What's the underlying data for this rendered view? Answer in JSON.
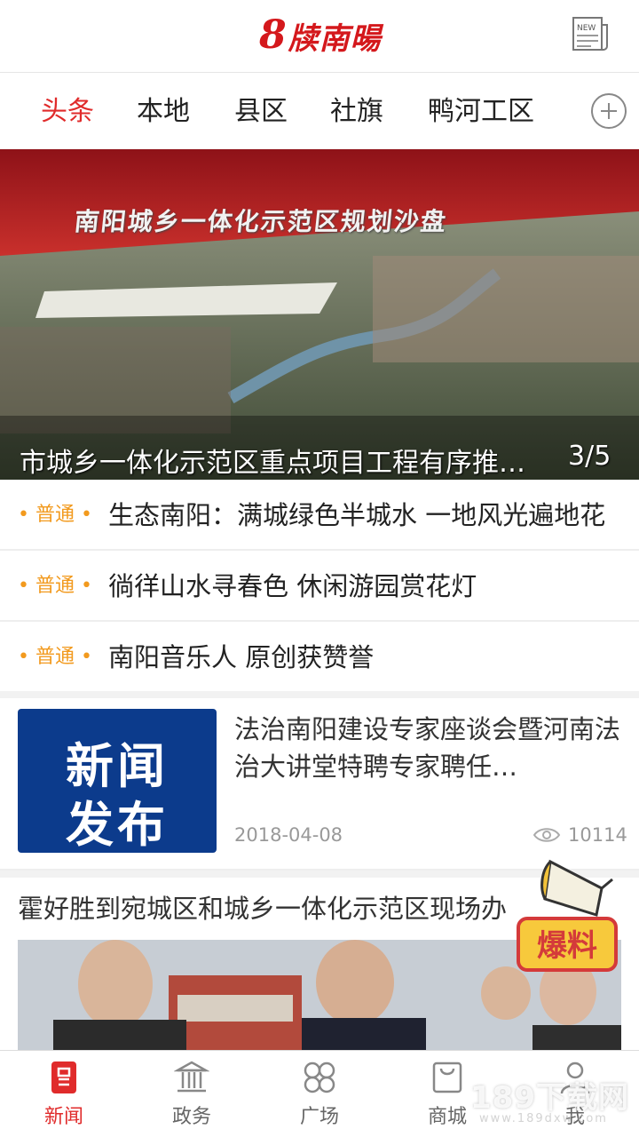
{
  "header": {
    "logo_mark": "8",
    "logo_text": "牍南暘",
    "news_icon": "newspaper-icon",
    "news_icon_label": "NEW"
  },
  "tabs": [
    {
      "label": "头条",
      "active": true
    },
    {
      "label": "本地",
      "active": false
    },
    {
      "label": "县区",
      "active": false
    },
    {
      "label": "社旗",
      "active": false
    },
    {
      "label": "鸭河工区",
      "active": false
    }
  ],
  "add_tab_icon": "plus-circle-icon",
  "hero": {
    "overlay_title": "南阳城乡一体化示范区规划沙盘",
    "caption": "市城乡一体化示范区重点项目工程有序推…",
    "counter": "3/5"
  },
  "news_list": [
    {
      "tag": "• 普通 •",
      "title": "生态南阳：满城绿色半城水 一地风光遍地花"
    },
    {
      "tag": "• 普通 •",
      "title": "徜徉山水寻春色 休闲游园赏花灯"
    },
    {
      "tag": "• 普通 •",
      "title": "南阳音乐人 原创获赞誉"
    }
  ],
  "card": {
    "thumb_line1": "新闻",
    "thumb_line2": "发布",
    "title": "法治南阳建设专家座谈会暨河南法治大讲堂特聘专家聘任…",
    "date": "2018-04-08",
    "views": "10114",
    "views_icon": "eye-icon"
  },
  "article": {
    "title": "霍好胜到宛城区和城乡一体化示范区现场办"
  },
  "badge": {
    "label": "爆料"
  },
  "bottom_nav": [
    {
      "label": "新闻",
      "icon": "news-icon",
      "active": true
    },
    {
      "label": "政务",
      "icon": "government-icon",
      "active": false
    },
    {
      "label": "广场",
      "icon": "square-icon",
      "active": false
    },
    {
      "label": "商城",
      "icon": "shop-icon",
      "active": false
    },
    {
      "label": "我",
      "icon": "user-icon",
      "active": false
    }
  ],
  "watermark": {
    "text": "189下载网",
    "sub": "www.189dxw.com"
  },
  "colors": {
    "accent": "#e02b2b",
    "tag": "#f29a1e",
    "thumb": "#0c3b8c"
  }
}
